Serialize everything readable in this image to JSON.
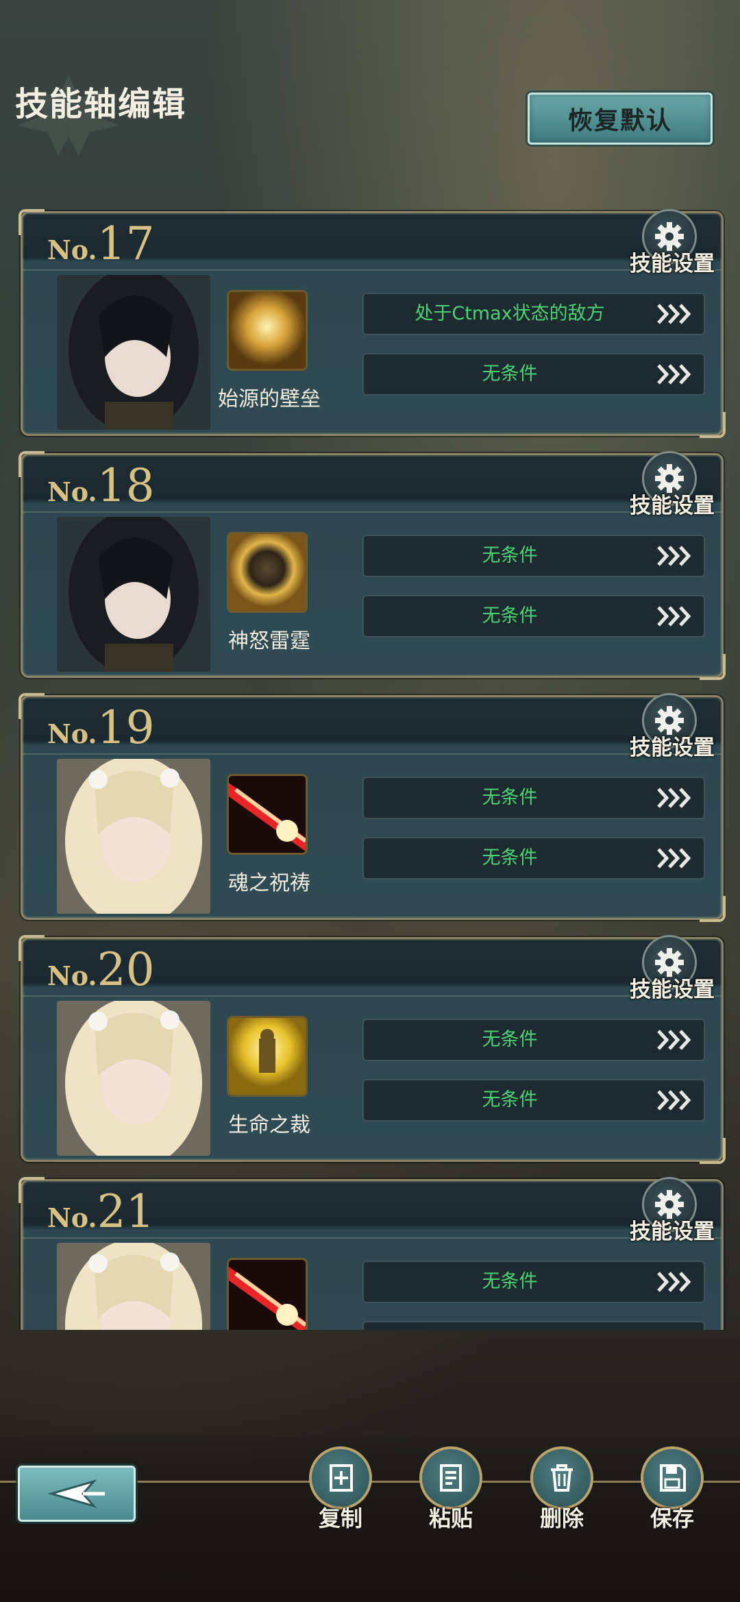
{
  "header": {
    "title": "技能轴编辑",
    "reset_button": "恢复默认"
  },
  "gear_label": "技能设置",
  "cards": [
    {
      "prefix": "No.",
      "number": "17",
      "skill_name": "始源的壁垒",
      "conditions": [
        "处于Ctmax状态的敌方",
        "无条件"
      ]
    },
    {
      "prefix": "No.",
      "number": "18",
      "skill_name": "神怒雷霆",
      "conditions": [
        "无条件",
        "无条件"
      ]
    },
    {
      "prefix": "No.",
      "number": "19",
      "skill_name": "魂之祝祷",
      "conditions": [
        "无条件",
        "无条件"
      ]
    },
    {
      "prefix": "No.",
      "number": "20",
      "skill_name": "生命之裁",
      "conditions": [
        "无条件",
        "无条件"
      ]
    },
    {
      "prefix": "No.",
      "number": "21",
      "skill_name": "",
      "conditions": [
        "无条件",
        ""
      ]
    }
  ],
  "toolbar": {
    "copy": "复制",
    "paste": "粘贴",
    "delete": "删除",
    "save": "保存"
  },
  "colors": {
    "condition_text": "#4bd273",
    "number_gold": "#d8c184",
    "teal_button": "#4b8a8f"
  }
}
